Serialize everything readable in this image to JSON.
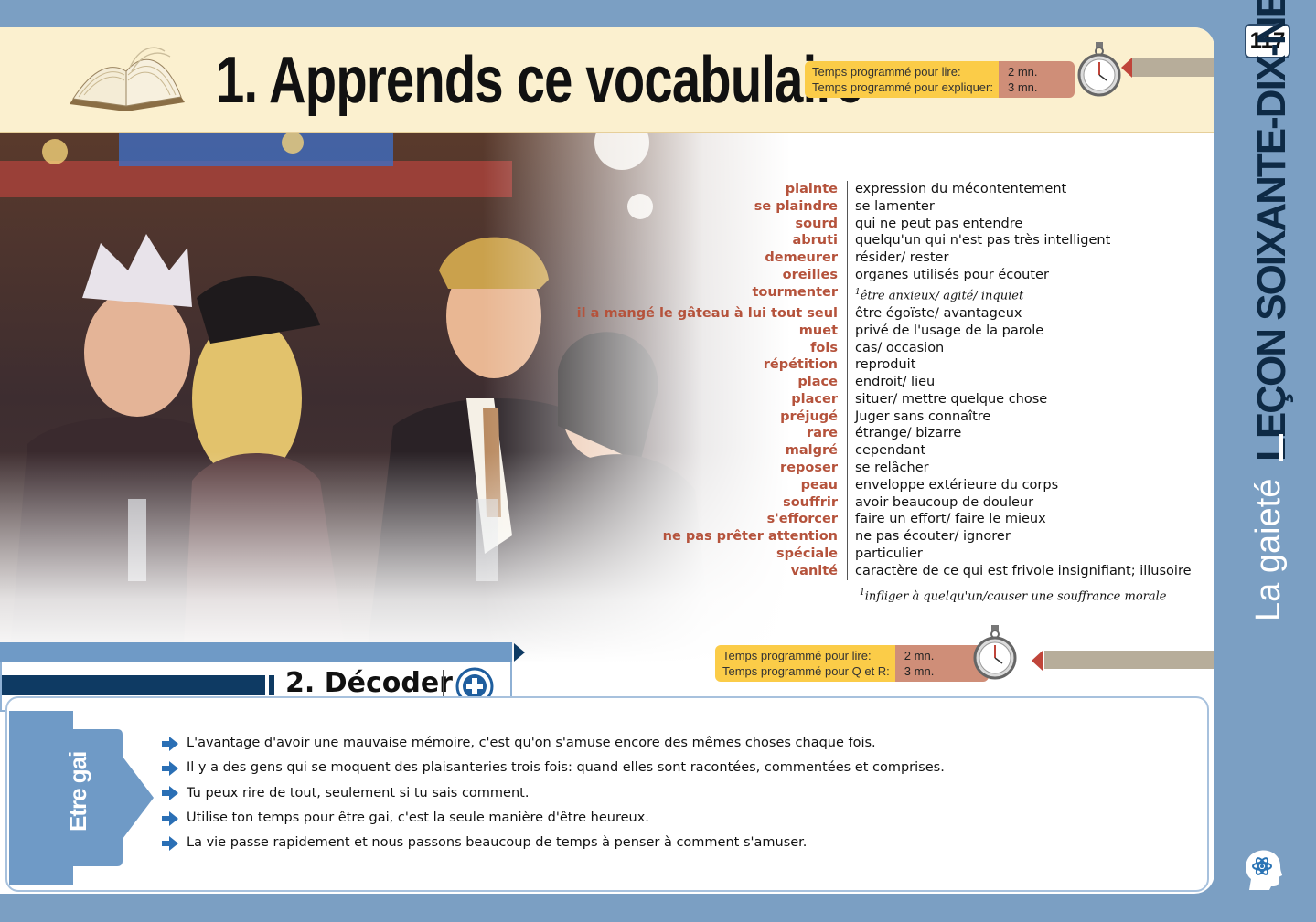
{
  "header": {
    "title": "1. Apprends ce vocabulaire",
    "timer_label_read": "Temps programmé pour lire:",
    "timer_label_explain": "Temps programmé pour expliquer:",
    "timer_value_read": "2 mn.",
    "timer_value_explain": "3 mn."
  },
  "page_number": "117",
  "sidebar": {
    "lesson": "LEÇON SOIXANTE-DIX-NEUF",
    "theme": "La gaieté"
  },
  "vocabulary": [
    {
      "term": "plainte",
      "definition": "expression du mécontentement"
    },
    {
      "term": "se plaindre",
      "definition": "se lamenter"
    },
    {
      "term": "sourd",
      "definition": "qui ne peut pas entendre"
    },
    {
      "term": "abruti",
      "definition": "quelqu'un qui n'est pas très intelligent"
    },
    {
      "term": "demeurer",
      "definition": "résider/ rester"
    },
    {
      "term": "oreilles",
      "definition": "organes utilisés pour écouter"
    },
    {
      "term": "tourmenter",
      "definition": "être anxieux/ agité/ inquiet",
      "footnote_mark": "1"
    },
    {
      "term": "il a mangé le gâteau à lui tout seul",
      "definition": "être égoïste/ avantageux"
    },
    {
      "term": "muet",
      "definition": "privé de l'usage de la parole"
    },
    {
      "term": "fois",
      "definition": "cas/ occasion"
    },
    {
      "term": "répétition",
      "definition": "reproduit"
    },
    {
      "term": "place",
      "definition": "endroit/ lieu"
    },
    {
      "term": "placer",
      "definition": "situer/ mettre quelque chose"
    },
    {
      "term": "préjugé",
      "definition": "Juger sans connaître"
    },
    {
      "term": "rare",
      "definition": "étrange/ bizarre"
    },
    {
      "term": "malgré",
      "definition": "cependant"
    },
    {
      "term": "reposer",
      "definition": "se relâcher"
    },
    {
      "term": "peau",
      "definition": "enveloppe extérieure du corps"
    },
    {
      "term": "souffrir",
      "definition": "avoir beaucoup de douleur"
    },
    {
      "term": "s'efforcer",
      "definition": "faire un effort/ faire le mieux"
    },
    {
      "term": "ne pas prêter attention",
      "definition": "ne pas écouter/ ignorer"
    },
    {
      "term": "spéciale",
      "definition": "particulier"
    },
    {
      "term": "vanité",
      "definition": "caractère de ce qui est frivole insignifiant; illusoire"
    }
  ],
  "footnote": {
    "mark": "1",
    "text": "infliger à quelqu'un/causer une souffrance morale"
  },
  "section2": {
    "title": "2. Décoder",
    "timer_label_read": "Temps programmé pour lire:",
    "timer_label_qr": "Temps programmé pour Q et R:",
    "timer_value_read": "2 mn.",
    "timer_value_qr": "3 mn.",
    "side_label": "Etre gai",
    "quotes": [
      "L'avantage d'avoir une mauvaise mémoire, c'est qu'on s'amuse encore des mêmes choses chaque fois.",
      "Il y a des gens qui se moquent des plaisanteries trois fois: quand elles sont racontées, commentées et comprises.",
      "Tu peux rire de tout, seulement si tu sais comment.",
      "Utilise ton temps pour être gai, c'est la seule manière d'être heureux.",
      "La vie passe rapidement et nous passons beaucoup de temps à penser à comment s'amuser."
    ]
  },
  "colors": {
    "background": "#7b9fc3",
    "term": "#b5533c",
    "timer_label": "#fbcc48",
    "timer_value": "#cf8e78",
    "navy": "#0e3a63"
  }
}
